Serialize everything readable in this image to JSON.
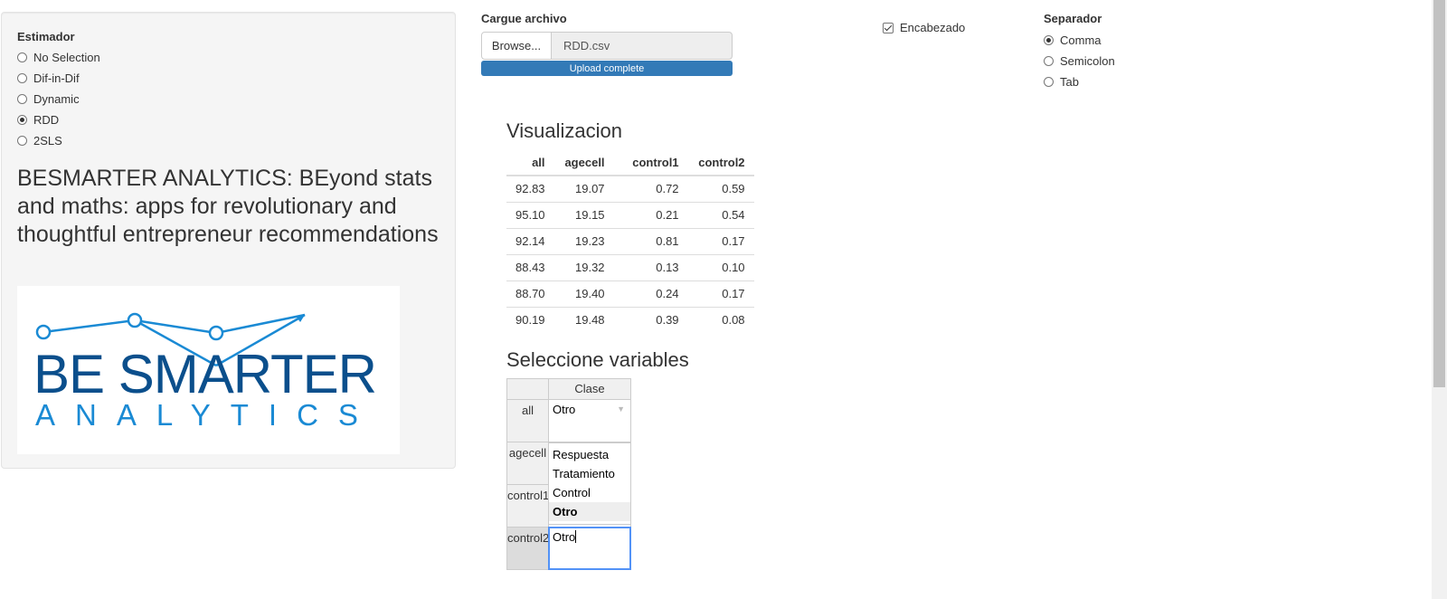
{
  "sidebar": {
    "estimator_label": "Estimador",
    "options": [
      {
        "label": "No Selection",
        "selected": false
      },
      {
        "label": "Dif-in-Dif",
        "selected": false
      },
      {
        "label": "Dynamic",
        "selected": false
      },
      {
        "label": "RDD",
        "selected": true
      },
      {
        "label": "2SLS",
        "selected": false
      }
    ],
    "headline": "BESMARTER ANALYTICS: BEyond stats and maths: apps for revolutionary and thoughtful entrepreneur recommendations",
    "logo": {
      "line1": "BE SMARTER",
      "line2": "ANALYTICS",
      "primary_color": "#0b4f8c",
      "accent_color": "#1a8ad4"
    }
  },
  "upload": {
    "label": "Cargue archivo",
    "browse_label": "Browse...",
    "file_name": "RDD.csv",
    "status": "Upload complete",
    "progress": 1.0
  },
  "header_checkbox": {
    "label": "Encabezado",
    "checked": true
  },
  "separator": {
    "label": "Separador",
    "options": [
      {
        "label": "Comma",
        "selected": true
      },
      {
        "label": "Semicolon",
        "selected": false
      },
      {
        "label": "Tab",
        "selected": false
      }
    ]
  },
  "visualization": {
    "title": "Visualizacion",
    "columns": [
      "all",
      "agecell",
      "control1",
      "control2"
    ],
    "rows": [
      [
        "92.83",
        "19.07",
        "0.72",
        "0.59"
      ],
      [
        "95.10",
        "19.15",
        "0.21",
        "0.54"
      ],
      [
        "92.14",
        "19.23",
        "0.81",
        "0.17"
      ],
      [
        "88.43",
        "19.32",
        "0.13",
        "0.10"
      ],
      [
        "88.70",
        "19.40",
        "0.24",
        "0.17"
      ],
      [
        "90.19",
        "19.48",
        "0.39",
        "0.08"
      ]
    ]
  },
  "variables": {
    "title": "Seleccione variables",
    "column_header": "Clase",
    "rows": [
      {
        "name": "all",
        "value": "Otro"
      },
      {
        "name": "agecell",
        "value": ""
      },
      {
        "name": "control1",
        "value": ""
      },
      {
        "name": "control2",
        "value": "Otro"
      }
    ],
    "dropdown_options": [
      "Respuesta",
      "Tratamiento",
      "Control",
      "Otro"
    ],
    "dropdown_selected": "Otro"
  },
  "colors": {
    "accent": "#337ab7",
    "editor_border": "#5292f7",
    "well_bg": "#f5f5f5"
  }
}
